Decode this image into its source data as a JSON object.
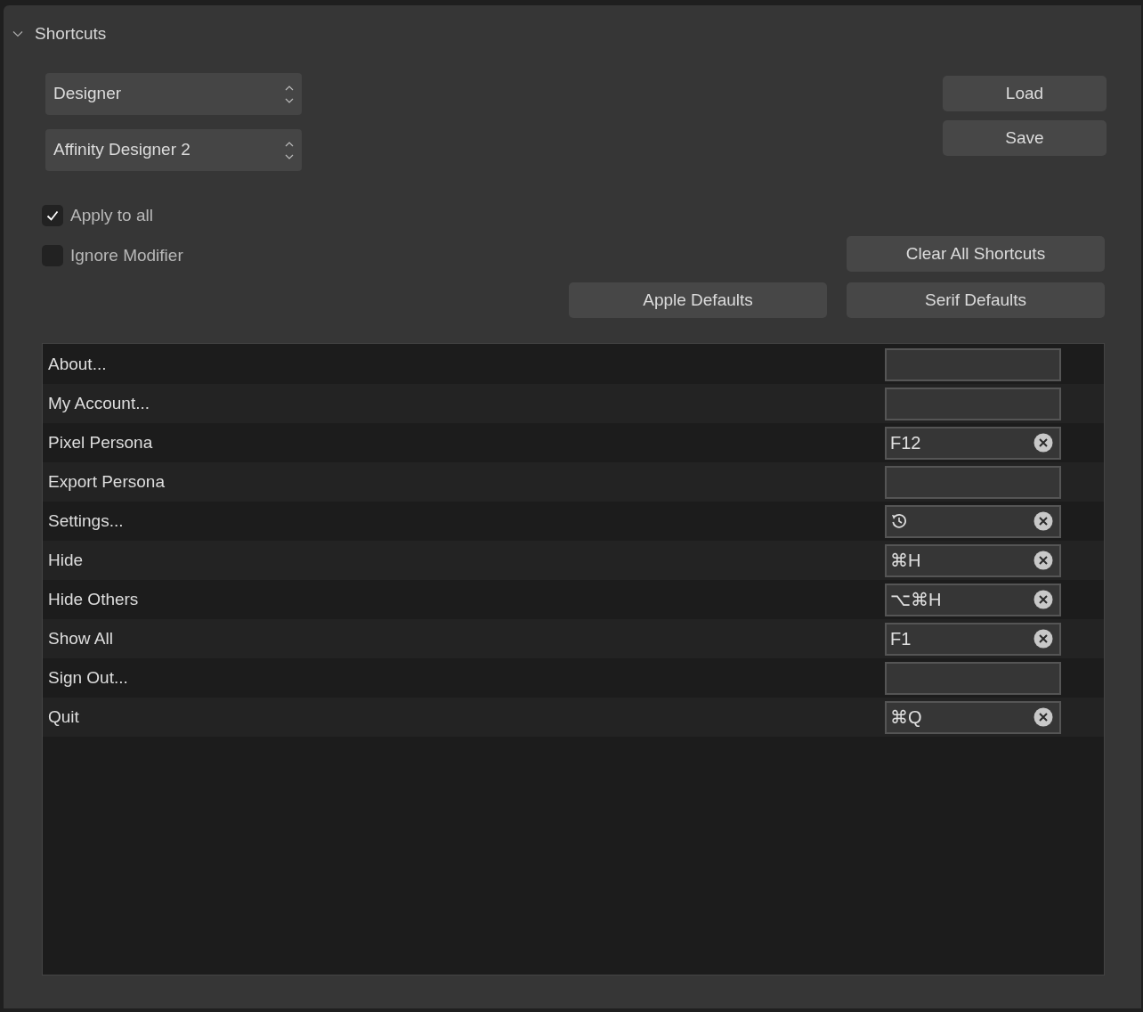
{
  "section": {
    "title": "Shortcuts",
    "expanded": true
  },
  "selects": [
    {
      "value": "Designer"
    },
    {
      "value": "Affinity Designer 2"
    }
  ],
  "file_buttons": [
    "Load",
    "Save"
  ],
  "checkboxes": [
    {
      "label": "Apply to all",
      "checked": true
    },
    {
      "label": "Ignore Modifier",
      "checked": false
    }
  ],
  "clear_button": "Clear All Shortcuts",
  "default_buttons": [
    "Apple Defaults",
    "Serif Defaults"
  ],
  "rows": [
    {
      "label": "About...",
      "kind": "empty"
    },
    {
      "label": "My Account...",
      "kind": "empty"
    },
    {
      "label": "Pixel Persona",
      "kind": "keys",
      "keys": "F12"
    },
    {
      "label": "Export Persona",
      "kind": "empty"
    },
    {
      "label": "Settings...",
      "kind": "reset"
    },
    {
      "label": "Hide",
      "kind": "keys",
      "keys": "⌘H"
    },
    {
      "label": "Hide Others",
      "kind": "keys",
      "keys": "⌥⌘H"
    },
    {
      "label": "Show All",
      "kind": "keys",
      "keys": "F1"
    },
    {
      "label": "Sign Out...",
      "kind": "empty"
    },
    {
      "label": "Quit",
      "kind": "keys",
      "keys": "⌘Q"
    }
  ]
}
